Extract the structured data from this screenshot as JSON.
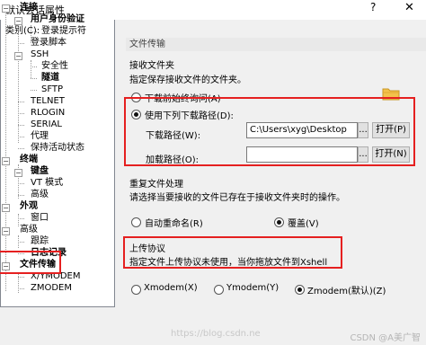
{
  "window": {
    "title": "默认会话属性",
    "help": "?",
    "close": "✕"
  },
  "category_label": "类别(C):",
  "tree": [
    {
      "label": "连接",
      "bold": true
    },
    {
      "label": "用户身份验证",
      "bold": true
    },
    {
      "label": "登录提示符",
      "bold": false
    },
    {
      "label": "登录脚本",
      "bold": false
    },
    {
      "label": "SSH",
      "bold": false
    },
    {
      "label": "安全性",
      "bold": false
    },
    {
      "label": "隧道",
      "bold": true
    },
    {
      "label": "SFTP",
      "bold": false
    },
    {
      "label": "TELNET",
      "bold": false
    },
    {
      "label": "RLOGIN",
      "bold": false
    },
    {
      "label": "SERIAL",
      "bold": false
    },
    {
      "label": "代理",
      "bold": false
    },
    {
      "label": "保持活动状态",
      "bold": false
    },
    {
      "label": "终端",
      "bold": true
    },
    {
      "label": "键盘",
      "bold": true
    },
    {
      "label": "VT 模式",
      "bold": false
    },
    {
      "label": "高级",
      "bold": false
    },
    {
      "label": "外观",
      "bold": true
    },
    {
      "label": "窗口",
      "bold": false
    },
    {
      "label": "高级",
      "bold": false
    },
    {
      "label": "跟踪",
      "bold": false
    },
    {
      "label": "日志记录",
      "bold": true
    },
    {
      "label": "文件传输",
      "bold": true
    },
    {
      "label": "X/YMODEM",
      "bold": false
    },
    {
      "label": "ZMODEM",
      "bold": false
    }
  ],
  "panel": {
    "section_title": "文件传输",
    "receive": {
      "group_title": "接收文件夹",
      "desc": "指定保存接收文件的文件夹。",
      "ask_option": "下载前始终询问(A)",
      "use_path_option": "使用下列下载路径(D):",
      "download_path_label": "下载路径(W):",
      "download_path_value": "C:\\Users\\xyg\\Desktop",
      "browse_label": "...",
      "open_label": "打开(P)",
      "load_path_label": "加载路径(O):",
      "load_path_value": "",
      "open2_label": "打开(N)"
    },
    "duplicate": {
      "group_title": "重复文件处理",
      "desc": "请选择当要接收的文件已存在于接收文件夹时的操作。",
      "auto_rename": "自动重命名(R)",
      "overwrite": "覆盖(V)"
    },
    "upload": {
      "group_title": "上传协议",
      "desc": "指定文件上传协议未使用，当你拖放文件到Xshell",
      "xmodem": "Xmodem(X)",
      "ymodem": "Ymodem(Y)",
      "zmodem": "Zmodem(默认)(Z)"
    }
  },
  "watermark": "CSDN @A美广智",
  "watermark_url": "https://blog.csdn.ne",
  "highlight_color": "#e52020"
}
